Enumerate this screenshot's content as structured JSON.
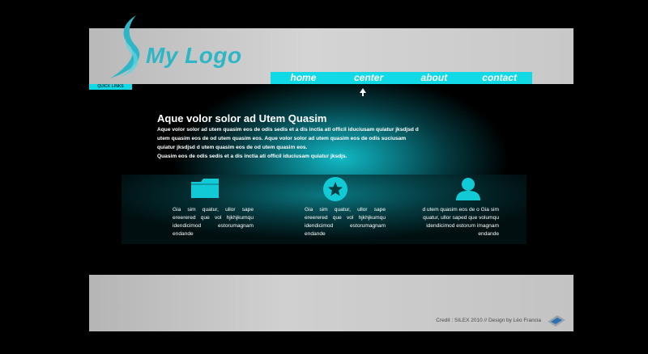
{
  "header": {
    "logo_text": "My Logo",
    "nav": [
      "home",
      "center",
      "about",
      "contact"
    ],
    "quick_links": "QUICK LINKS"
  },
  "hero": {
    "title": "Aque volor solor ad Utem Quasim",
    "paragraphs": [
      "Aque volor solor ad utem quasim eos de odis sedis et a dis inctia ati officil iduciusam quiatur jksdjsd d utem quasim eos de od utem quasim eos. Aque volor solor ad utem quasim eos de odis suciusam quiatur jksdjsd d utem quasim eos de od utem quasim eos.",
      "Quasim eos de odis sedis et a dis inctia ati officil iduciusam quiatur jksdjs."
    ]
  },
  "features": [
    {
      "icon": "folder-icon",
      "text": "Gia sim quatur, ullor sape ereerered que vol hjkhjkumqu idendicimod estorumagnam endande"
    },
    {
      "icon": "star-icon",
      "text": "Gia sim quatur, ullor sape ereerered que vol hjkhjkumqu idendicimod estorumagnam endande"
    },
    {
      "icon": "user-icon",
      "text": "d utem quasim eos de o Gia sim quatur, ullor saped que volumqu idendicimod estorum imagnam endande"
    }
  ],
  "footer": {
    "credit": "Credit : SILEX 2010 // Design by Léo Francia",
    "badge": "SILEX"
  },
  "colors": {
    "accent": "#12d9e6",
    "logo": "#2cb6c6",
    "background": "#000000",
    "panel": "#c8c8c8"
  }
}
